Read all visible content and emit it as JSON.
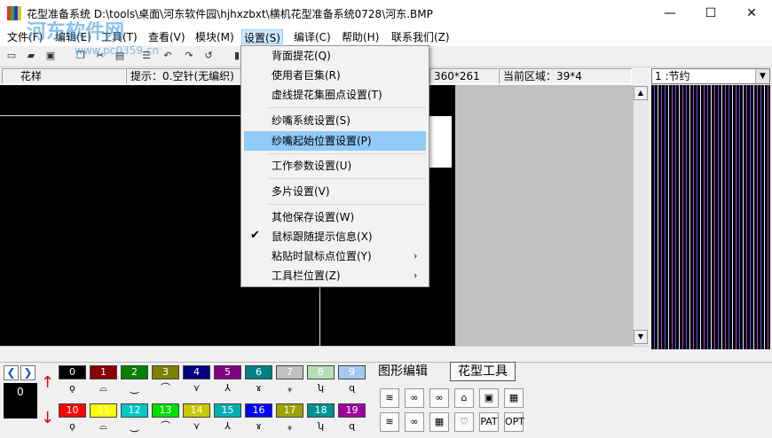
{
  "window": {
    "title": "花型准备系统 D:\\tools\\桌面\\河东软件园\\hjhxzbxt\\横机花型准备系统0728\\河东.BMP",
    "minimize": "—",
    "maximize": "☐",
    "close": "✕"
  },
  "watermark": {
    "text": "河东软件网",
    "url": "www.pc0359.cn"
  },
  "menubar": [
    {
      "label": "文件(F)"
    },
    {
      "label": "编辑(E)"
    },
    {
      "label": "工具(T)"
    },
    {
      "label": "查看(V)"
    },
    {
      "label": "模块(M)"
    },
    {
      "label": "设置(S)"
    },
    {
      "label": "编译(C)"
    },
    {
      "label": "帮助(H)"
    },
    {
      "label": "联系我们(Z)"
    }
  ],
  "toolbar_icons": [
    "new-icon",
    "open-icon",
    "save-icon",
    "copy-icon",
    "cut-icon",
    "paste-icon",
    "grid-icon",
    "undo-icon",
    "redo-icon",
    "opt-icon",
    "opt2-icon",
    "brush-icon"
  ],
  "status": {
    "label": "花样",
    "hint": "提示：0.空针(无编织)",
    "size": "360*261",
    "region": "当前区域：39*4"
  },
  "right_panel": {
    "selected": "1   :节约"
  },
  "settings_menu": {
    "items": [
      {
        "label": "背面提花(Q)"
      },
      {
        "label": "使用者巨集(R)"
      },
      {
        "label": "虚线提花集圈点设置(T)"
      },
      {
        "label": "纱嘴系统设置(S)"
      },
      {
        "label": "纱嘴起始位置设置(P)"
      },
      {
        "label": "工作参数设置(U)"
      },
      {
        "label": "多片设置(V)"
      },
      {
        "label": "其他保存设置(W)"
      },
      {
        "label": "鼠标跟随提示信息(X)"
      },
      {
        "label": "粘贴时鼠标点位置(Y)"
      },
      {
        "label": "工具栏位置(Z)"
      }
    ],
    "check_glyph": "✔",
    "submenu_glyph": "›"
  },
  "bottom": {
    "current_index": "0",
    "colors_row1": [
      {
        "n": "0",
        "bg": "#000000",
        "fg": "#ffffff"
      },
      {
        "n": "1",
        "bg": "#8b0000",
        "fg": "#ffffff"
      },
      {
        "n": "2",
        "bg": "#008000",
        "fg": "#ffffff"
      },
      {
        "n": "3",
        "bg": "#808000",
        "fg": "#ffffff"
      },
      {
        "n": "4",
        "bg": "#000080",
        "fg": "#ffffff"
      },
      {
        "n": "5",
        "bg": "#800080",
        "fg": "#ffffff"
      },
      {
        "n": "6",
        "bg": "#008080",
        "fg": "#ffffff"
      },
      {
        "n": "7",
        "bg": "#c0c0c0",
        "fg": "#ffffff"
      },
      {
        "n": "8",
        "bg": "#b4e0b4",
        "fg": "#ffffff"
      },
      {
        "n": "9",
        "bg": "#a6c8f0",
        "fg": "#ffffff"
      }
    ],
    "colors_row2": [
      {
        "n": "10",
        "bg": "#ff0000",
        "fg": "#ffffff"
      },
      {
        "n": "11",
        "bg": "#ffff00",
        "fg": "#ffffff"
      },
      {
        "n": "12",
        "bg": "#00c8c8",
        "fg": "#ffffff"
      },
      {
        "n": "13",
        "bg": "#00e000",
        "fg": "#ffffff"
      },
      {
        "n": "14",
        "bg": "#c8c800",
        "fg": "#ffffff"
      },
      {
        "n": "15",
        "bg": "#00b0b0",
        "fg": "#ffffff"
      },
      {
        "n": "16",
        "bg": "#0000ff",
        "fg": "#ffffff"
      },
      {
        "n": "17",
        "bg": "#a0a000",
        "fg": "#ffffff"
      },
      {
        "n": "18",
        "bg": "#009090",
        "fg": "#ffffff"
      },
      {
        "n": "19",
        "bg": "#a000a0",
        "fg": "#ffffff"
      }
    ],
    "tab_graphic": "图形编辑",
    "tab_pattern": "花型工具",
    "tools_row1": [
      "≋",
      "∞",
      "∞",
      "⌂",
      "▣",
      "▦"
    ],
    "tools_row2": [
      "≋",
      "∞",
      "▦",
      "♡",
      "PAT",
      "OPT"
    ]
  }
}
